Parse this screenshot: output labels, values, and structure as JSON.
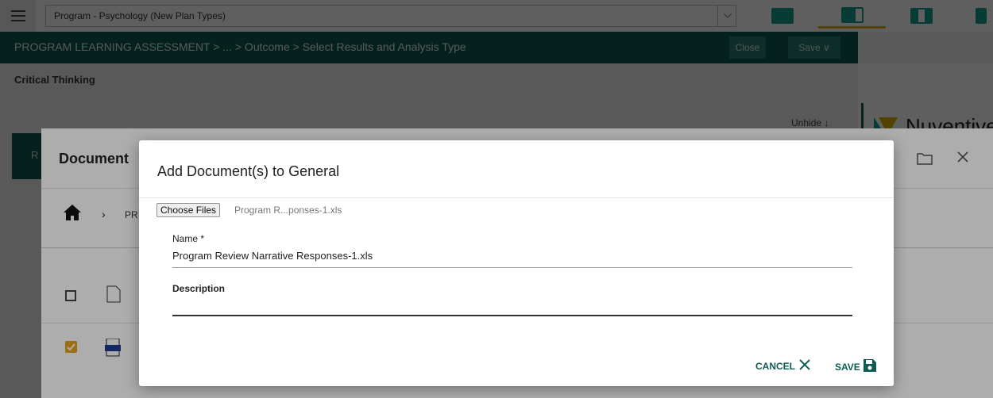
{
  "topbar": {
    "plan_select": "Program - Psychology (New Plan Types)",
    "menu_icon": "hamburger-icon",
    "caret_icon": "chevron-down-icon"
  },
  "breadcrumb": {
    "text": "PROGRAM LEARNING ASSESSMENT > ... > Outcome > Select Results and Analysis Type",
    "close_label": "Close",
    "save_label": "Save ∨"
  },
  "subtitle": "Critical Thinking",
  "background": {
    "unhide_label": "Unhide ↓",
    "logo_text": "Nuventive",
    "doc_panel_title": "Document",
    "tab_letter": "R",
    "path_prefix": "PR"
  },
  "dialog": {
    "title": "Add Document(s) to General",
    "choose_files_label": "Choose Files",
    "chosen_file": "Program R...ponses-1.xls",
    "name_label": "Name *",
    "name_value": "Program Review Narrative Responses-1.xls",
    "description_label": "Description",
    "cancel_label": "CANCEL",
    "save_label": "SAVE"
  },
  "colors": {
    "brand": "#0d5c53",
    "checkbox_checked": "#e8a317"
  }
}
